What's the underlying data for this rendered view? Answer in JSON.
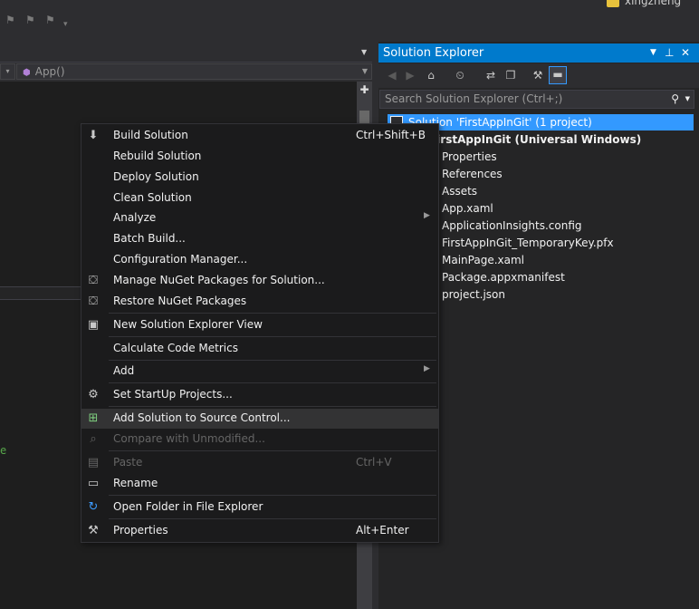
{
  "topbar": {
    "user_name": "xingzheng"
  },
  "editor": {
    "member_dropdown": "App()",
    "code_fragment": "e"
  },
  "solution_explorer": {
    "title": "Solution Explorer",
    "search_placeholder": "Search Solution Explorer (Ctrl+;)",
    "solution_label": "Solution 'FirstAppInGit' (1 project)",
    "project_label": "FirstAppInGit (Universal Windows)",
    "items": [
      "Properties",
      "References",
      "Assets",
      "App.xaml",
      "ApplicationInsights.config",
      "FirstAppInGit_TemporaryKey.pfx",
      "MainPage.xaml",
      "Package.appxmanifest",
      "project.json"
    ]
  },
  "context_menu": {
    "items": [
      {
        "label": "Build Solution",
        "shortcut": "Ctrl+Shift+B",
        "icon": "build-icon"
      },
      {
        "label": "Rebuild Solution"
      },
      {
        "label": "Deploy Solution"
      },
      {
        "label": "Clean Solution"
      },
      {
        "label": "Analyze",
        "submenu": true
      },
      {
        "label": "Batch Build..."
      },
      {
        "label": "Configuration Manager..."
      },
      {
        "label": "Manage NuGet Packages for Solution...",
        "icon": "nuget-icon"
      },
      {
        "label": "Restore NuGet Packages",
        "icon": "nuget-restore-icon"
      },
      {
        "label": "New Solution Explorer View",
        "icon": "new-view-icon"
      },
      {
        "label": "Calculate Code Metrics"
      },
      {
        "label": "Add",
        "submenu": true
      },
      {
        "label": "Set StartUp Projects...",
        "icon": "gear-icon"
      },
      {
        "label": "Add Solution to Source Control...",
        "icon": "source-control-add-icon",
        "highlighted": true
      },
      {
        "label": "Compare with Unmodified...",
        "disabled": true,
        "icon": "compare-icon"
      },
      {
        "label": "Paste",
        "shortcut": "Ctrl+V",
        "disabled": true,
        "icon": "paste-icon"
      },
      {
        "label": "Rename",
        "icon": "rename-icon"
      },
      {
        "label": "Open Folder in File Explorer",
        "icon": "refresh-folder-icon"
      },
      {
        "label": "Properties",
        "shortcut": "Alt+Enter",
        "icon": "wrench-icon"
      }
    ]
  },
  "colors": {
    "accent": "#007acc",
    "selection": "#3399ff",
    "menu_bg": "#1b1b1c",
    "highlight": "#333334"
  }
}
